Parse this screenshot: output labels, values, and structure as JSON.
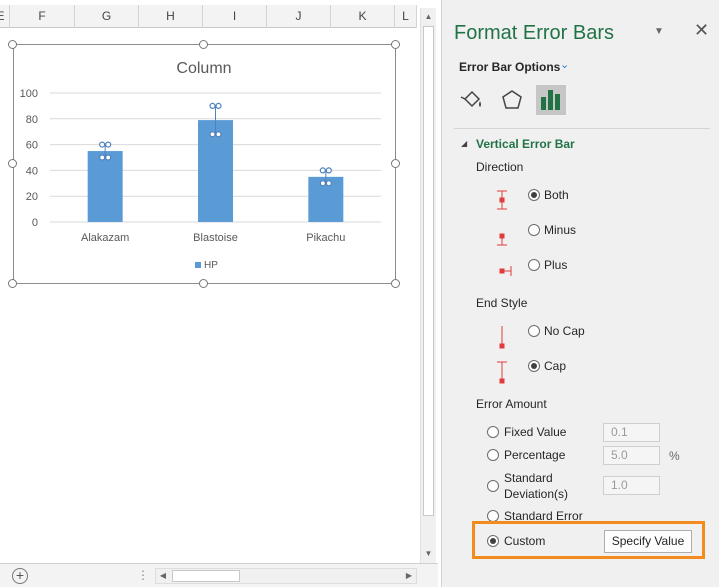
{
  "sheet": {
    "columns": [
      "E",
      "F",
      "G",
      "H",
      "I",
      "J",
      "K",
      "L"
    ]
  },
  "chart_data": {
    "type": "bar",
    "title": "Column",
    "categories": [
      "Alakazam",
      "Blastoise",
      "Pikachu"
    ],
    "series": [
      {
        "name": "HP",
        "values": [
          55,
          79,
          35
        ],
        "color": "#5b9bd5"
      }
    ],
    "error_bars": {
      "plus": [
        60,
        90,
        40
      ],
      "minus": [
        50,
        68,
        30
      ]
    },
    "ylim": [
      0,
      100
    ],
    "yticks": [
      0,
      20,
      40,
      60,
      80,
      100
    ],
    "grid": true,
    "legend": "bottom"
  },
  "pane": {
    "title": "Format Error Bars",
    "options_label": "Error Bar Options",
    "section_title": "Vertical Error Bar",
    "direction_label": "Direction",
    "direction_options": {
      "both": "Both",
      "minus": "Minus",
      "plus": "Plus"
    },
    "direction_selected": "Both",
    "end_style_label": "End Style",
    "end_style_options": {
      "no_cap": "No Cap",
      "cap": "Cap"
    },
    "end_style_selected": "Cap",
    "error_amount_label": "Error Amount",
    "error_amount_options": {
      "fixed": "Fixed Value",
      "percentage": "Percentage",
      "stddev_line1": "Standard",
      "stddev_line2": "Deviation(s)",
      "stderr": "Standard Error",
      "custom": "Custom"
    },
    "error_amount_selected": "Custom",
    "fixed_value": "0.1",
    "percentage_value": "5.0",
    "percent_sign": "%",
    "stddev_value": "1.0",
    "specify_button": "Specify Value",
    "accent_color": "#217346",
    "highlight_color": "#f38b1d",
    "icons": [
      "fill-line-icon",
      "effects-icon",
      "bar-chart-options-icon"
    ]
  }
}
